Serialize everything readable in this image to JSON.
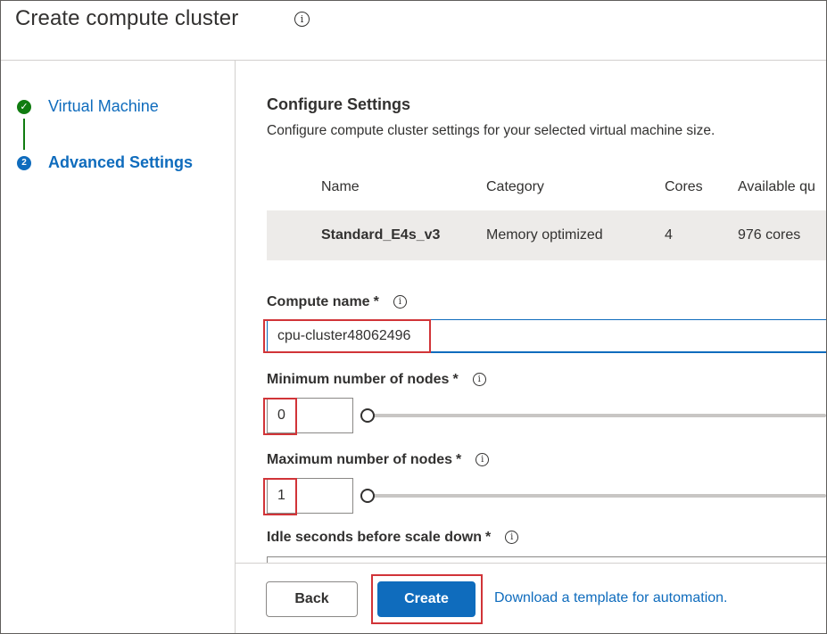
{
  "header": {
    "title": "Create compute cluster",
    "info_glyph": "i"
  },
  "sidebar": {
    "steps": [
      {
        "label": "Virtual Machine",
        "status": "complete",
        "icon": "check-circle-icon",
        "glyph": "✓"
      },
      {
        "label": "Advanced Settings",
        "status": "active",
        "icon": "step-number-icon",
        "glyph": "2"
      }
    ]
  },
  "main": {
    "section_title": "Configure Settings",
    "section_desc": "Configure compute cluster settings for your selected virtual machine size.",
    "vm_table": {
      "headers": [
        "Name",
        "Category",
        "Cores",
        "Available qu"
      ],
      "row": [
        "Standard_E4s_v3",
        "Memory optimized",
        "4",
        "976 cores"
      ]
    },
    "compute_name": {
      "label": "Compute name",
      "required_mark": "*",
      "value": "cpu-cluster48062496"
    },
    "min_nodes": {
      "label": "Minimum number of nodes",
      "required_mark": "*",
      "value": "0",
      "slider_fraction": 0
    },
    "max_nodes": {
      "label": "Maximum number of nodes",
      "required_mark": "*",
      "value": "1",
      "slider_fraction": 0
    },
    "idle_seconds": {
      "label": "Idle seconds before scale down",
      "required_mark": "*"
    }
  },
  "footer": {
    "back_label": "Back",
    "create_label": "Create",
    "template_link": "Download a template for automation."
  },
  "colors": {
    "accent": "#0f6cbd",
    "success": "#107c10",
    "highlight": "#d13438"
  }
}
